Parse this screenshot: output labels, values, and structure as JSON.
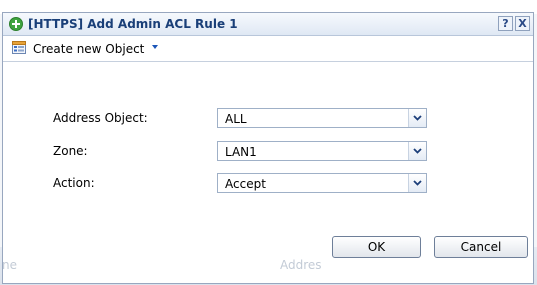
{
  "background": {
    "header_left": "ne",
    "header_right": "Addres"
  },
  "dialog": {
    "title": "[HTTPS] Add Admin ACL Rule 1",
    "help_label": "?",
    "close_label": "X"
  },
  "toolbar": {
    "create_label": "Create new Object"
  },
  "form": {
    "address": {
      "label": "Address Object:",
      "value": "ALL"
    },
    "zone": {
      "label": "Zone:",
      "value": "LAN1"
    },
    "action": {
      "label": "Action:",
      "value": "Accept"
    }
  },
  "buttons": {
    "ok_label": "OK",
    "cancel_label": "Cancel"
  },
  "colors": {
    "title_text": "#1a3f78",
    "accent": "#1b55b8"
  }
}
